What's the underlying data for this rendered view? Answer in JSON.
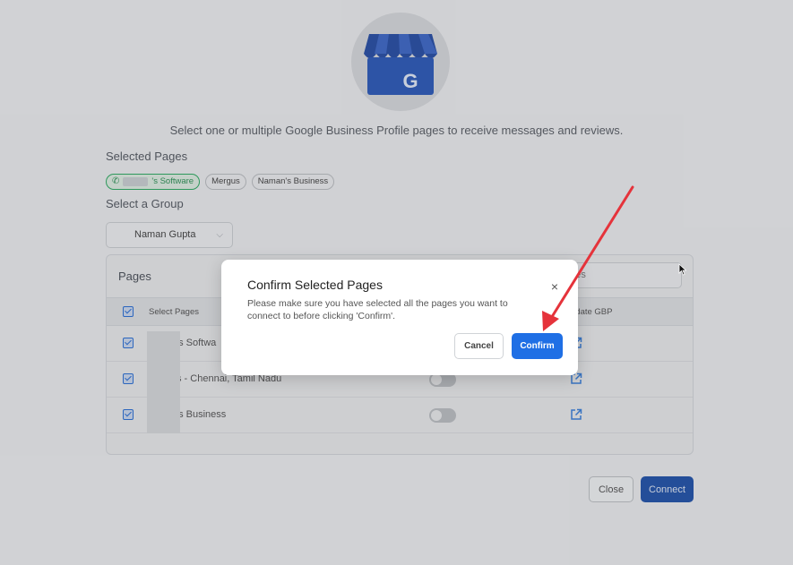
{
  "intro": "Select one or multiple Google Business Profile pages to receive messages and reviews.",
  "selected_pages_label": "Selected Pages",
  "chips": [
    {
      "text": "'s Software",
      "active": true,
      "icon": "phone-icon"
    },
    {
      "text": "Mergus",
      "active": false
    },
    {
      "text": "Naman's Business",
      "active": false
    }
  ],
  "group_label": "Select a Group",
  "group_value": "Naman Gupta",
  "pages_card": {
    "title": "Pages",
    "search_visible": "ages",
    "col_select": "Select Pages",
    "col_update": "pdate GBP",
    "rows": [
      {
        "name": "'s Softwa",
        "checked": true
      },
      {
        "name": "s - Chennai, Tamil Nadu",
        "checked": true
      },
      {
        "name": "'s Business",
        "checked": true
      }
    ]
  },
  "footer": {
    "close": "Close",
    "connect": "Connect"
  },
  "modal": {
    "title": "Confirm Selected Pages",
    "body": "Please make sure you have selected all the pages you want to connect to before clicking 'Confirm'.",
    "close_icon": "×",
    "cancel": "Cancel",
    "confirm": "Confirm"
  },
  "colors": {
    "accent": "#1f6fe5",
    "annotation_arrow": "#e5333b",
    "active_chip": "#2fa862"
  }
}
